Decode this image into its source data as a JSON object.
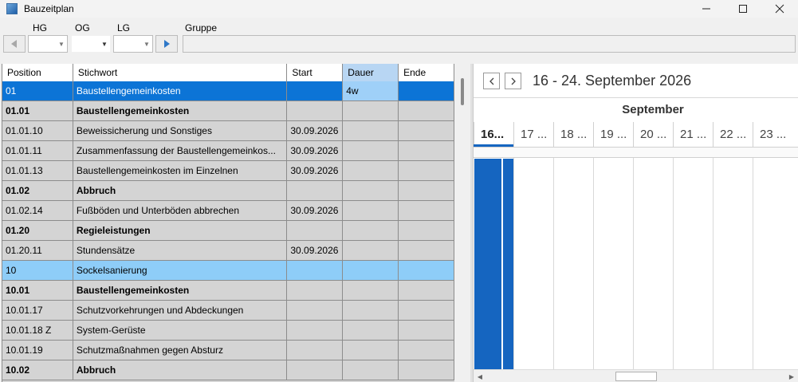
{
  "window": {
    "title": "Bauzeitplan"
  },
  "toolbar": {
    "labels": {
      "hg": "HG",
      "og": "OG",
      "lg": "LG",
      "gruppe": "Gruppe"
    }
  },
  "table": {
    "headers": {
      "position": "Position",
      "stichwort": "Stichwort",
      "start": "Start",
      "dauer": "Dauer",
      "ende": "Ende"
    },
    "rows": [
      {
        "pos": "01",
        "text": "Baustellengemeinkosten",
        "start": "",
        "dauer": "4w",
        "ende": "",
        "style": "selected"
      },
      {
        "pos": "01.01",
        "text": "Baustellengemeinkosten",
        "start": "",
        "dauer": "",
        "ende": "",
        "style": "bold"
      },
      {
        "pos": "01.01.10",
        "text": "Beweissicherung und Sonstiges",
        "start": "30.09.2026",
        "dauer": "",
        "ende": "",
        "style": ""
      },
      {
        "pos": "01.01.11",
        "text": "Zusammenfassung der Baustellengemeinkos...",
        "start": "30.09.2026",
        "dauer": "",
        "ende": "",
        "style": ""
      },
      {
        "pos": "01.01.13",
        "text": "Baustellengemeinkosten im Einzelnen",
        "start": "30.09.2026",
        "dauer": "",
        "ende": "",
        "style": ""
      },
      {
        "pos": "01.02",
        "text": "Abbruch",
        "start": "",
        "dauer": "",
        "ende": "",
        "style": "bold"
      },
      {
        "pos": "01.02.14",
        "text": "Fußböden und Unterböden abbrechen",
        "start": "30.09.2026",
        "dauer": "",
        "ende": "",
        "style": ""
      },
      {
        "pos": "01.20",
        "text": "Regieleistungen",
        "start": "",
        "dauer": "",
        "ende": "",
        "style": "bold"
      },
      {
        "pos": "01.20.11",
        "text": "Stundensätze",
        "start": "30.09.2026",
        "dauer": "",
        "ende": "",
        "style": ""
      },
      {
        "pos": "10",
        "text": "Sockelsanierung",
        "start": "",
        "dauer": "",
        "ende": "",
        "style": "highlight"
      },
      {
        "pos": "10.01",
        "text": "Baustellengemeinkosten",
        "start": "",
        "dauer": "",
        "ende": "",
        "style": "bold"
      },
      {
        "pos": "10.01.17",
        "text": "Schutzvorkehrungen und Abdeckungen",
        "start": "",
        "dauer": "",
        "ende": "",
        "style": ""
      },
      {
        "pos": "10.01.18  Z",
        "text": "System-Gerüste",
        "start": "",
        "dauer": "",
        "ende": "",
        "style": ""
      },
      {
        "pos": "10.01.19",
        "text": "Schutzmaßnahmen gegen Absturz",
        "start": "",
        "dauer": "",
        "ende": "",
        "style": ""
      },
      {
        "pos": "10.02",
        "text": "Abbruch",
        "start": "",
        "dauer": "",
        "ende": "",
        "style": "bold"
      }
    ]
  },
  "calendar": {
    "range": "16 - 24. September 2026",
    "month": "September",
    "days": [
      "16...",
      "17 ...",
      "18 ...",
      "19 ...",
      "20 ...",
      "21 ...",
      "22 ...",
      "23 ..."
    ],
    "today_index": 0
  },
  "colors": {
    "selection": "#0c74d6",
    "highlight": "#8ecdf8",
    "gantt": "#1565c0",
    "header_active": "#b8d6f3"
  }
}
